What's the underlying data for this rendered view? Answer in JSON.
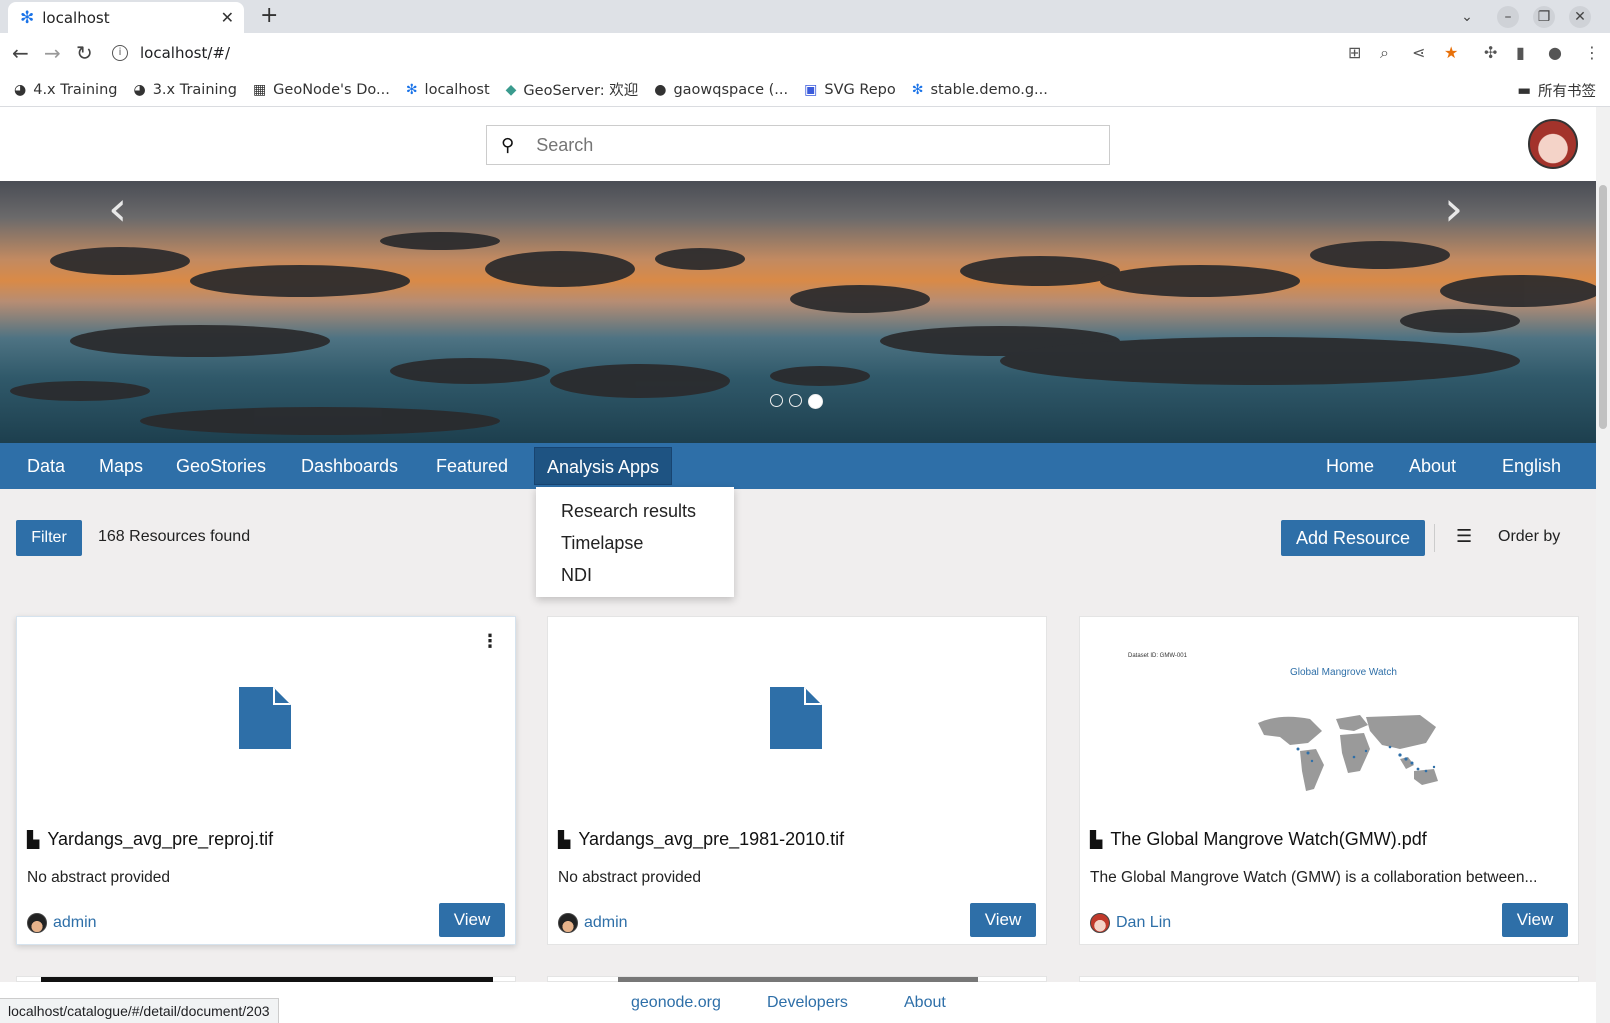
{
  "browser": {
    "tab_title": "localhost",
    "url": "localhost/#/",
    "bookmarks": [
      {
        "icon": "globe-icon",
        "label": "4.x Training"
      },
      {
        "icon": "globe-icon",
        "label": "3.x Training"
      },
      {
        "icon": "building-icon",
        "label": "GeoNode's Do..."
      },
      {
        "icon": "geonode-icon",
        "label": "localhost"
      },
      {
        "icon": "geoserver-icon",
        "label": "GeoServer: 欢迎"
      },
      {
        "icon": "github-icon",
        "label": "gaowqspace (..."
      },
      {
        "icon": "svg-icon",
        "label": "SVG Repo"
      },
      {
        "icon": "geonode-icon",
        "label": "stable.demo.g..."
      }
    ],
    "all_bookmarks": "所有书签",
    "status_url": "localhost/catalogue/#/detail/document/203"
  },
  "header": {
    "search_placeholder": "Search"
  },
  "hero": {
    "prev": "‹",
    "next": "›",
    "slide_count": 3,
    "active_slide": 3
  },
  "nav": {
    "left": [
      "Data",
      "Maps",
      "GeoStories",
      "Dashboards",
      "Featured",
      "Analysis Apps"
    ],
    "right": [
      "Home",
      "About",
      "English"
    ],
    "active": "Analysis Apps",
    "dropdown": [
      "Research results",
      "Timelapse",
      "NDI"
    ]
  },
  "filter_bar": {
    "filter_label": "Filter",
    "count_text": "168 Resources found",
    "add_resource": "Add Resource",
    "order_by": "Order by"
  },
  "cards": [
    {
      "title": "Yardangs_avg_pre_reproj.tif",
      "abstract": "No abstract provided",
      "author": "admin",
      "view": "View"
    },
    {
      "title": "Yardangs_avg_pre_1981-2010.tif",
      "abstract": "No abstract provided",
      "author": "admin",
      "view": "View"
    },
    {
      "title": "The Global Mangrove Watch(GMW).pdf",
      "abstract": "The Global Mangrove Watch (GMW) is a collaboration between...",
      "author": "Dan Lin",
      "view": "View",
      "thumb_id_label": "Dataset ID:    GMW-001",
      "thumb_title": "Global Mangrove Watch"
    }
  ],
  "footer": [
    "geonode.org",
    "Developers",
    "About"
  ],
  "colors": {
    "primary": "#2e6fa8",
    "primary_dark": "#1e5382"
  }
}
